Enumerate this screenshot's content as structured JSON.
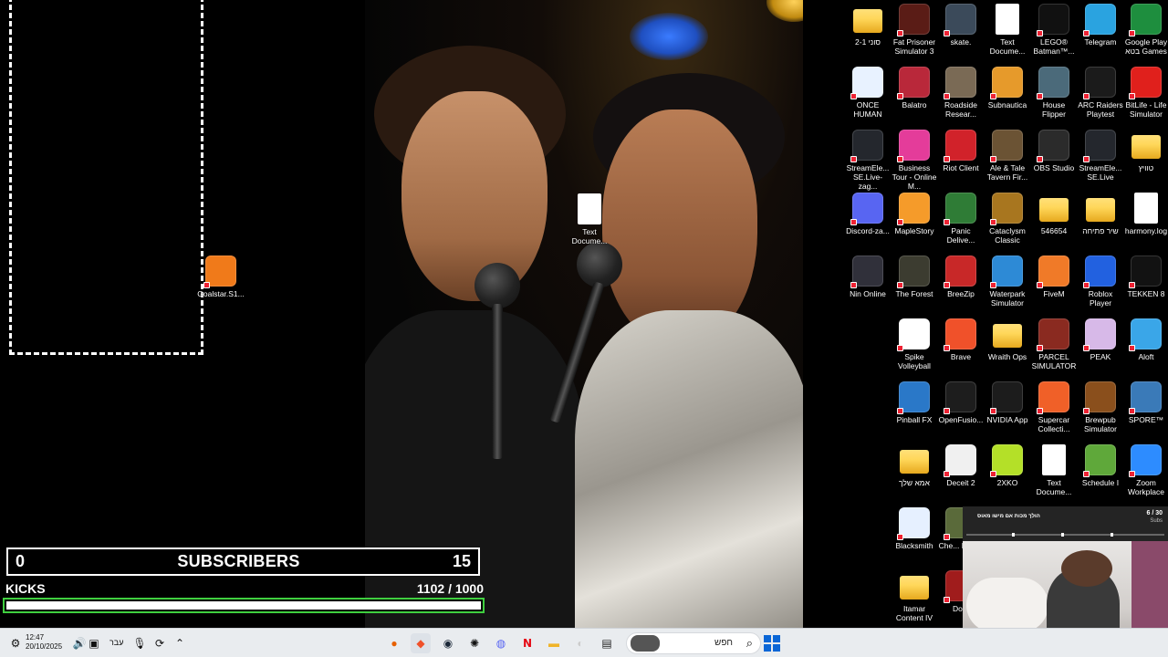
{
  "desktop_icons": [
    {
      "label": "סוני 2-1",
      "kind": "folder",
      "color": "#ffd75a"
    },
    {
      "label": "Fat Prisoner Simulator 3",
      "kind": "app",
      "color": "#5a1c16"
    },
    {
      "label": "skate.",
      "kind": "app",
      "color": "#3b4a5a"
    },
    {
      "label": "Text Docume...",
      "kind": "doc",
      "color": "#ffffff"
    },
    {
      "label": "LEGO® Batman™...",
      "kind": "app",
      "color": "#111111"
    },
    {
      "label": "Telegram",
      "kind": "app",
      "color": "#2aa3e0"
    },
    {
      "label": "Google Play בטא Games",
      "kind": "app",
      "color": "#1e8e3e"
    },
    {
      "label": "ONCE HUMAN",
      "kind": "app",
      "color": "#e8f2ff"
    },
    {
      "label": "Balatro",
      "kind": "app",
      "color": "#b9283a"
    },
    {
      "label": "Roadside Resear...",
      "kind": "app",
      "color": "#7a6a55"
    },
    {
      "label": "Subnautica",
      "kind": "app",
      "color": "#e69a2b"
    },
    {
      "label": "House Flipper",
      "kind": "app",
      "color": "#4b6a7a"
    },
    {
      "label": "ARC Raiders Playtest",
      "kind": "app",
      "color": "#1b1b1b"
    },
    {
      "label": "BitLife - Life Simulator",
      "kind": "app",
      "color": "#e0201c"
    },
    {
      "label": "StreamEle... SE.Live-zag...",
      "kind": "app",
      "color": "#24272d"
    },
    {
      "label": "Business Tour - Online M...",
      "kind": "app",
      "color": "#e43c9a"
    },
    {
      "label": "Riot Client",
      "kind": "app",
      "color": "#d1222a"
    },
    {
      "label": "Ale & Tale Tavern Fir...",
      "kind": "app",
      "color": "#6b5334"
    },
    {
      "label": "OBS Studio",
      "kind": "app",
      "color": "#2b2b2b"
    },
    {
      "label": "StreamEle... SE.Live",
      "kind": "app",
      "color": "#24272d"
    },
    {
      "label": "טוויץ",
      "kind": "folder",
      "color": "#ffd75a"
    },
    {
      "label": "Discord-za...",
      "kind": "app",
      "color": "#5865f2"
    },
    {
      "label": "MapleStory",
      "kind": "app",
      "color": "#f59b2a"
    },
    {
      "label": "Panic Delive...",
      "kind": "app",
      "color": "#2f7c36"
    },
    {
      "label": "Cataclysm Classic",
      "kind": "app",
      "color": "#a8761f"
    },
    {
      "label": "546654",
      "kind": "folder",
      "color": "#ffd75a"
    },
    {
      "label": "שיר פתיחה",
      "kind": "folder",
      "color": "#ffd75a"
    },
    {
      "label": "harmony.log",
      "kind": "doc",
      "color": "#ffffff"
    },
    {
      "label": "Nin Online",
      "kind": "app",
      "color": "#30303a"
    },
    {
      "label": "The Forest",
      "kind": "app",
      "color": "#3c3c30"
    },
    {
      "label": "BreeZip",
      "kind": "app",
      "color": "#c82828"
    },
    {
      "label": "Waterpark Simulator",
      "kind": "app",
      "color": "#2d8ad6"
    },
    {
      "label": "FiveM",
      "kind": "app",
      "color": "#f07a28"
    },
    {
      "label": "Roblox Player",
      "kind": "app",
      "color": "#2261e0"
    },
    {
      "label": "TEKKEN 8",
      "kind": "app",
      "color": "#121212"
    },
    {
      "label": "Spike Volleyball",
      "kind": "app",
      "color": "#ffffff"
    },
    {
      "label": "Brave",
      "kind": "app",
      "color": "#f0512a"
    },
    {
      "label": "Wraith Ops",
      "kind": "folder",
      "color": "#ffd75a"
    },
    {
      "label": "PARCEL SIMULATOR",
      "kind": "app",
      "color": "#8a2a20"
    },
    {
      "label": "PEAK",
      "kind": "app",
      "color": "#d7b9e8"
    },
    {
      "label": "Aloft",
      "kind": "app",
      "color": "#3aa6e8"
    },
    {
      "label": "Pinball FX",
      "kind": "app",
      "color": "#2a78c8"
    },
    {
      "label": "OpenFusio...",
      "kind": "app",
      "color": "#1d1d1d"
    },
    {
      "label": "NVIDIA App",
      "kind": "app",
      "color": "#1c1c1c"
    },
    {
      "label": "Supercar Collecti...",
      "kind": "app",
      "color": "#f06028"
    },
    {
      "label": "Brewpub Simulator",
      "kind": "app",
      "color": "#8a4f1c"
    },
    {
      "label": "SPORE™",
      "kind": "app",
      "color": "#3a7ab8"
    },
    {
      "label": "אמא שלך",
      "kind": "folder",
      "color": "#ffd75a"
    },
    {
      "label": "Deceit 2",
      "kind": "app",
      "color": "#f0f0f0"
    },
    {
      "label": "2XKO",
      "kind": "app",
      "color": "#b4e028"
    },
    {
      "label": "Text Docume...",
      "kind": "doc",
      "color": "#ffffff"
    },
    {
      "label": "Schedule I",
      "kind": "app",
      "color": "#5fa83a"
    },
    {
      "label": "Zoom Workplace",
      "kind": "app",
      "color": "#2d8cff"
    },
    {
      "label": "Blacksmith",
      "kind": "app",
      "color": "#e6f0ff"
    },
    {
      "label": "Che... Rolli...",
      "kind": "app",
      "color": "#5a6a3a"
    },
    {
      "label": "Itamar Content IV",
      "kind": "folder",
      "color": "#ffd75a"
    },
    {
      "label": "Dota",
      "kind": "app",
      "color": "#a01c1c"
    },
    {
      "label": "Text Docume...",
      "kind": "doc",
      "color": "#ffffff"
    },
    {
      "label": "Goalstar.S1...",
      "kind": "app",
      "color": "#f07a1a"
    }
  ],
  "overlay": {
    "subs_left": "0",
    "subs_label": "SUBSCRIBERS",
    "subs_right": "15",
    "kicks_label": "KICKS",
    "kicks_count": "1102  / 1000",
    "kicks_progress": 1.0
  },
  "cam_widget": {
    "title": "הולך מכות אם מישו מאוס",
    "count": "6 / 30",
    "unit": "Subs"
  },
  "taskbar": {
    "time": "12:47",
    "date": "20/10/2025",
    "language": "עבר",
    "search_placeholder": "חפש",
    "accent": "#0a66d6"
  }
}
